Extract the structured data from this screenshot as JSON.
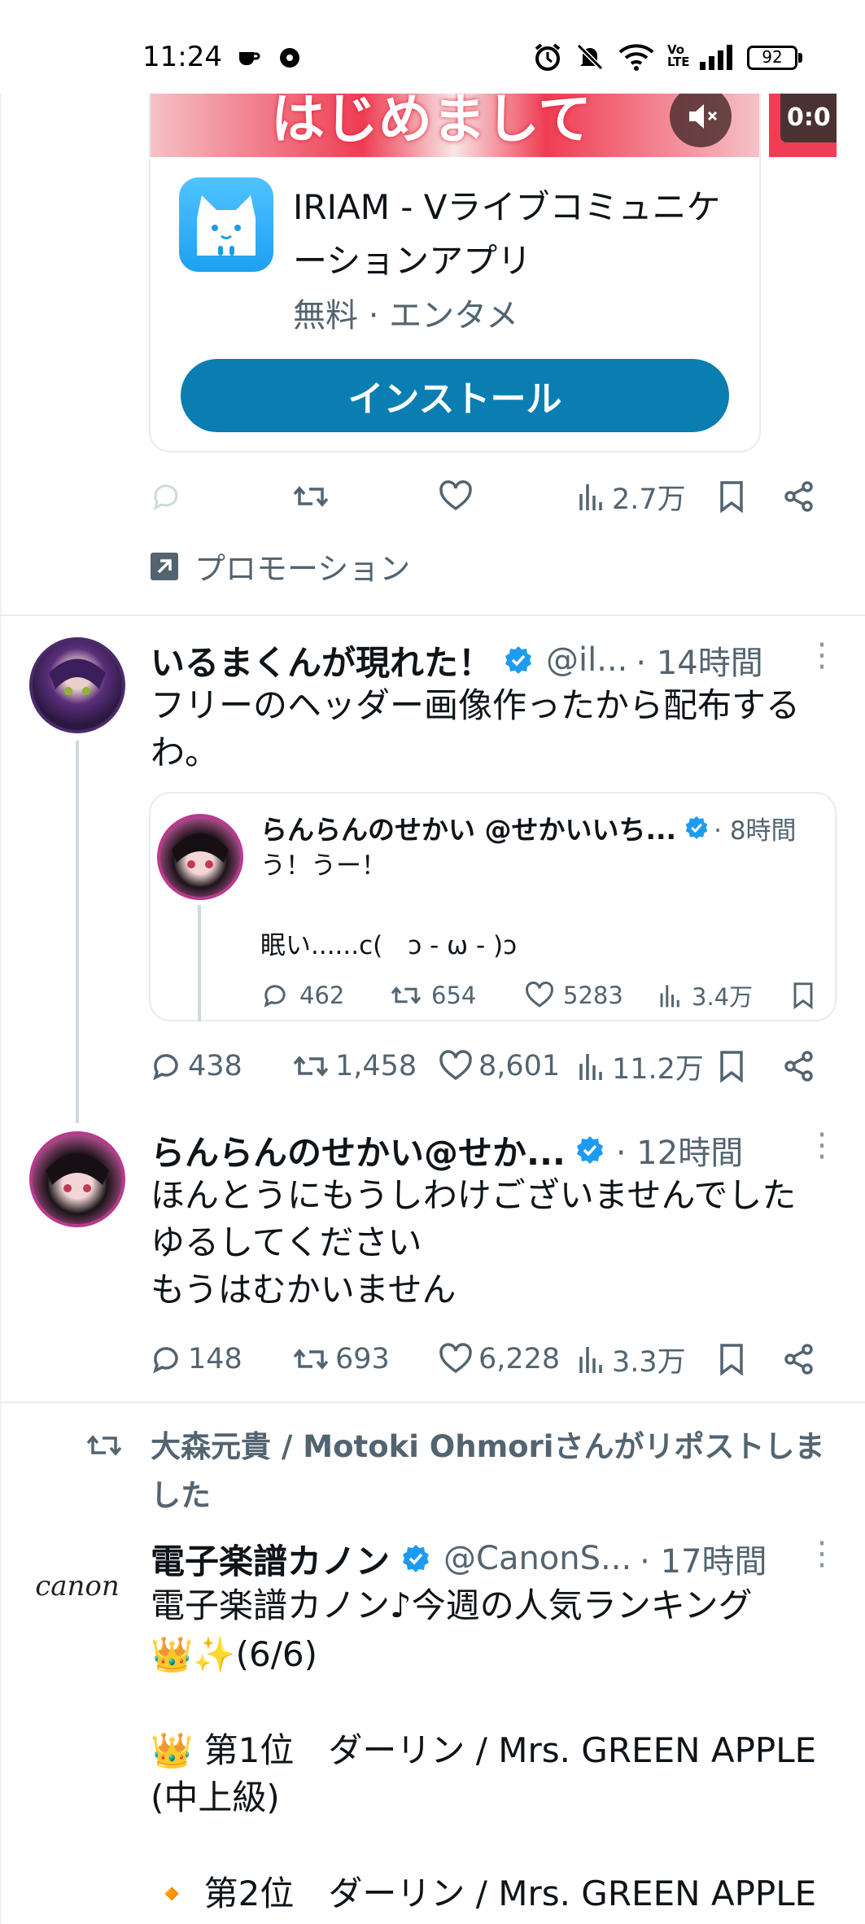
{
  "status_bar": {
    "time": "11:24",
    "battery": "92"
  },
  "promoted": {
    "banner_text": "はじめまして",
    "video_time": "0:0",
    "app_name": "IRIAM - Vライブコミュニケーションアプリ",
    "app_meta": "無料 · エンタメ",
    "install_label": "インストール",
    "views": "2.7万",
    "promotion_label": "プロモーション"
  },
  "tweet1": {
    "display_name": "いるまくんが現れた！",
    "handle": "@il...",
    "time": "· 14時間",
    "text": "フリーのヘッダー画像作ったから配布するわ。",
    "replies": "438",
    "retweets": "1,458",
    "likes": "8,601",
    "views": "11.2万",
    "quote": {
      "display_name": "らんらんのせかい @せかいいち...",
      "time": "· 8時間",
      "line1": "う！うー！",
      "line2": "眠い......c(　ɔ - ω - )ɔ",
      "replies": "462",
      "retweets": "654",
      "likes": "5283",
      "views": "3.4万"
    }
  },
  "tweet2": {
    "display_name": "らんらんのせかい@せか...",
    "time": "· 12時間",
    "line1": "ほんとうにもうしわけございませんでした",
    "line2": "ゆるしてください",
    "line3": "もうはむかいません",
    "replies": "148",
    "retweets": "693",
    "likes": "6,228",
    "views": "3.3万"
  },
  "tweet3": {
    "repost_by": "大森元貴 / Motoki Ohmoriさんがリポストしました",
    "avatar_text": "canon",
    "display_name": "電子楽譜カノン",
    "handle": "@CanonS...",
    "time": "· 17時間",
    "line1": "電子楽譜カノン♪今週の人気ランキング",
    "line2": "👑✨(6/6)",
    "line3": "👑 第1位　ダーリン / Mrs. GREEN APPLE",
    "line4": "(中上級)",
    "line5": "🔸 第2位　ダーリン / Mrs. GREEN APPLE"
  },
  "colors": {
    "accent": "#1d9bf0",
    "install_button": "#0a7eb1",
    "secondary_text": "#536471"
  }
}
